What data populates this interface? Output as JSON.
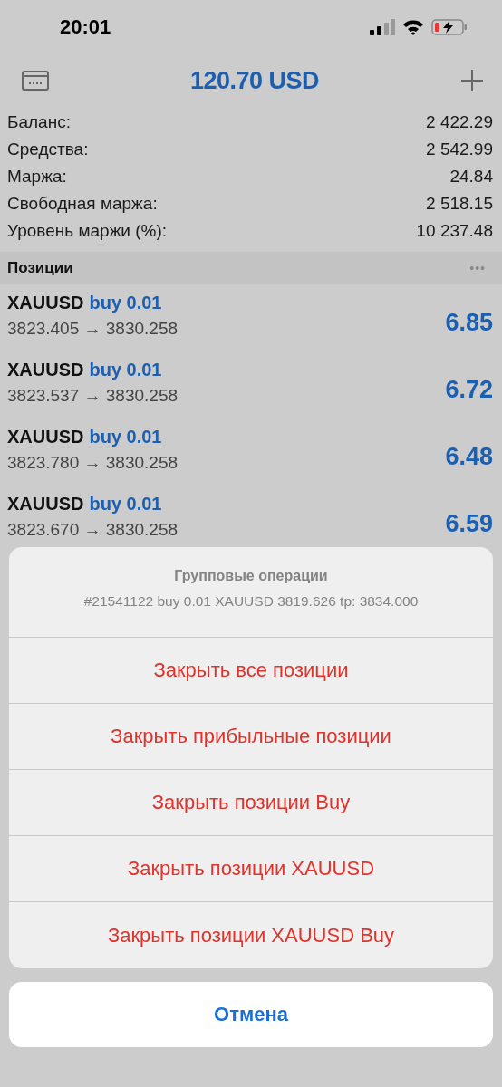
{
  "status_bar": {
    "time": "20:01"
  },
  "nav": {
    "title": "120.70 USD"
  },
  "summary": [
    {
      "label": "Баланс:",
      "value": "2 422.29"
    },
    {
      "label": "Средства:",
      "value": "2 542.99"
    },
    {
      "label": "Маржа:",
      "value": "24.84"
    },
    {
      "label": "Свободная маржа:",
      "value": "2 518.15"
    },
    {
      "label": "Уровень маржи (%):",
      "value": "10 237.48"
    }
  ],
  "positions_header": {
    "title": "Позиции",
    "menu": "•••"
  },
  "positions": [
    {
      "symbol": "XAUUSD",
      "side": "buy 0.01",
      "prices": "3823.405 → 3830.258",
      "profit": "6.85"
    },
    {
      "symbol": "XAUUSD",
      "side": "buy 0.01",
      "prices": "3823.537 → 3830.258",
      "profit": "6.72"
    },
    {
      "symbol": "XAUUSD",
      "side": "buy 0.01",
      "prices": "3823.780 → 3830.258",
      "profit": "6.48"
    },
    {
      "symbol": "XAUUSD",
      "side": "buy 0.01",
      "prices": "3823.670 → 3830.258",
      "profit": "6.59"
    }
  ],
  "action_sheet": {
    "title": "Групповые операции",
    "subtitle": "#21541122 buy 0.01 XAUUSD 3819.626 tp: 3834.000",
    "actions": [
      "Закрыть все позиции",
      "Закрыть прибыльные позиции",
      "Закрыть позиции Buy",
      "Закрыть позиции XAUUSD",
      "Закрыть позиции XAUUSD Buy"
    ],
    "cancel": "Отмена"
  }
}
